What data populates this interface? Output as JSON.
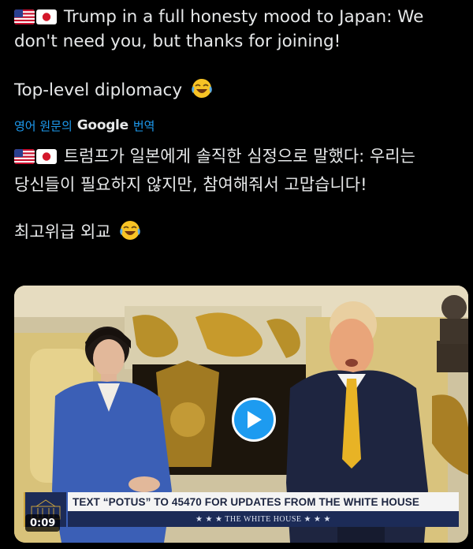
{
  "post": {
    "line1": "Trump in a full honesty mood to Japan: We",
    "line2": "don't need you, but thanks for joining!",
    "line3": "Top-level diplomacy",
    "emoji": "laughing-face-emoji",
    "flags": [
      "us-flag",
      "japan-flag"
    ]
  },
  "translation": {
    "prefix": "영어 원문의",
    "brand": "Google",
    "suffix": "번역",
    "line1": "트럼프가 일본에게 솔직한 심정으로 말했다: 우리는",
    "line2": "당신들이 필요하지 않지만, 참여해줘서 고맙습니다!",
    "line3": "최고위급 외교"
  },
  "video": {
    "timestamp": "0:09",
    "banner_text": "TEXT “POTUS” TO 45470 FOR UPDATES FROM THE WHITE HOUSE",
    "banner_sub": "★ ★ ★   THE WHITE HOUSE   ★ ★ ★",
    "play_icon": "play-icon"
  },
  "colors": {
    "background": "#000000",
    "text": "#e7e9ea",
    "link": "#1d9bf0",
    "banner_navy": "#1c2b57"
  }
}
